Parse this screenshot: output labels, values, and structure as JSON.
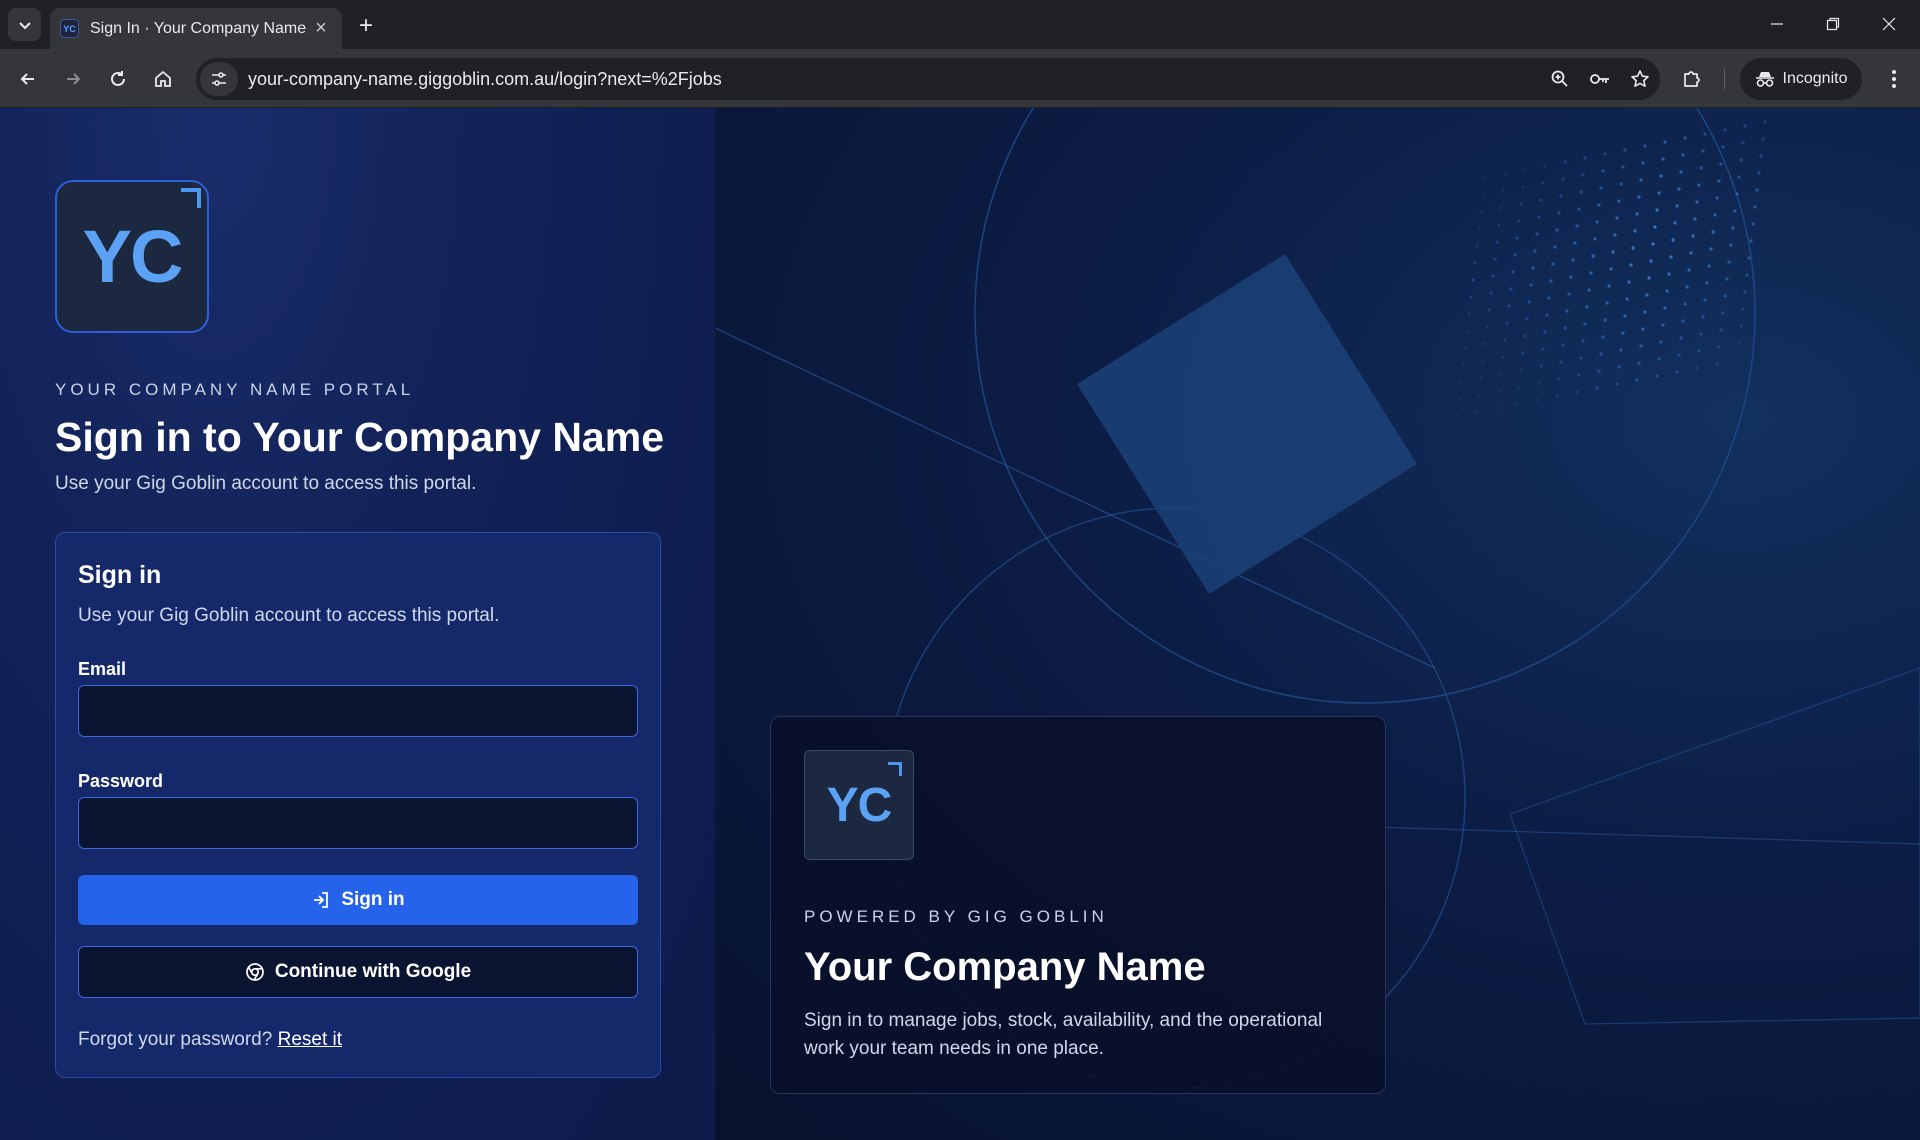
{
  "browser": {
    "tab_title": "Sign In · Your Company Name",
    "favicon_text": "YC",
    "url": "your-company-name.giggoblin.com.au/login?next=%2Fjobs",
    "incognito_label": "Incognito"
  },
  "brand": {
    "logo_text": "YC",
    "accent_color": "#2563eb",
    "logo_color": "#5ba2f5"
  },
  "hero": {
    "eyebrow": "YOUR COMPANY NAME PORTAL",
    "title": "Sign in to Your Company Name",
    "subtitle": "Use your Gig Goblin account to access this portal."
  },
  "signin_card": {
    "title": "Sign in",
    "subtitle": "Use your Gig Goblin account to access this portal.",
    "email_label": "Email",
    "email_value": "",
    "password_label": "Password",
    "password_value": "",
    "submit_label": "Sign in",
    "google_label": "Continue with Google",
    "forgot_text": "Forgot your password?",
    "reset_link": "Reset it"
  },
  "promo": {
    "logo_text": "YC",
    "eyebrow": "POWERED BY GIG GOBLIN",
    "title": "Your Company Name",
    "description": "Sign in to manage jobs, stock, availability, and the operational work your team needs in one place."
  }
}
